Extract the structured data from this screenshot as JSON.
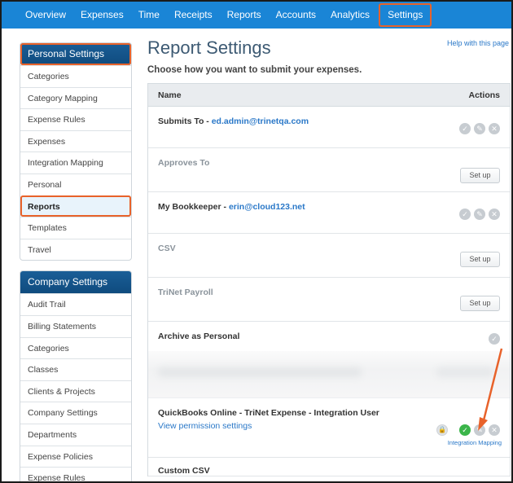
{
  "nav": {
    "items": [
      "Overview",
      "Expenses",
      "Time",
      "Receipts",
      "Reports",
      "Accounts",
      "Analytics",
      "Settings"
    ],
    "active": "Settings"
  },
  "sidebar": {
    "personal": {
      "header": "Personal Settings",
      "items": [
        "Categories",
        "Category Mapping",
        "Expense Rules",
        "Expenses",
        "Integration Mapping",
        "Personal",
        "Reports",
        "Templates",
        "Travel"
      ],
      "selected": "Reports"
    },
    "company": {
      "header": "Company Settings",
      "items": [
        "Audit Trail",
        "Billing Statements",
        "Categories",
        "Classes",
        "Clients & Projects",
        "Company Settings",
        "Departments",
        "Expense Policies",
        "Expense Rules"
      ]
    }
  },
  "main": {
    "title": "Report Settings",
    "help": "Help with this page",
    "subtitle": "Choose how you want to submit your expenses.",
    "table": {
      "col_name": "Name",
      "col_actions": "Actions",
      "rows": [
        {
          "label": "Submits To - ",
          "link": "ed.admin@trinetqa.com"
        },
        {
          "label": "Approves To",
          "button": "Set up"
        },
        {
          "label": "My Bookkeeper - ",
          "link": "erin@cloud123.net"
        },
        {
          "label": "CSV",
          "button": "Set up"
        },
        {
          "label": "TriNet Payroll",
          "button": "Set up"
        },
        {
          "label": "Archive as Personal"
        },
        {
          "label": "QuickBooks Online - TriNet Expense - Integration User",
          "perm_link": "View permission settings",
          "action_label": "Integration Mapping"
        },
        {
          "label": "Custom CSV"
        }
      ]
    }
  },
  "colors": {
    "nav_bg": "#1a85d6",
    "highlight": "#e8622a",
    "link": "#2a78c8",
    "sidebar_header": "#0f4b7e",
    "success": "#3bb54a"
  },
  "icons": [
    "check-icon",
    "edit-pencil-icon",
    "close-icon",
    "lock-icon",
    "arrow-icon"
  ]
}
